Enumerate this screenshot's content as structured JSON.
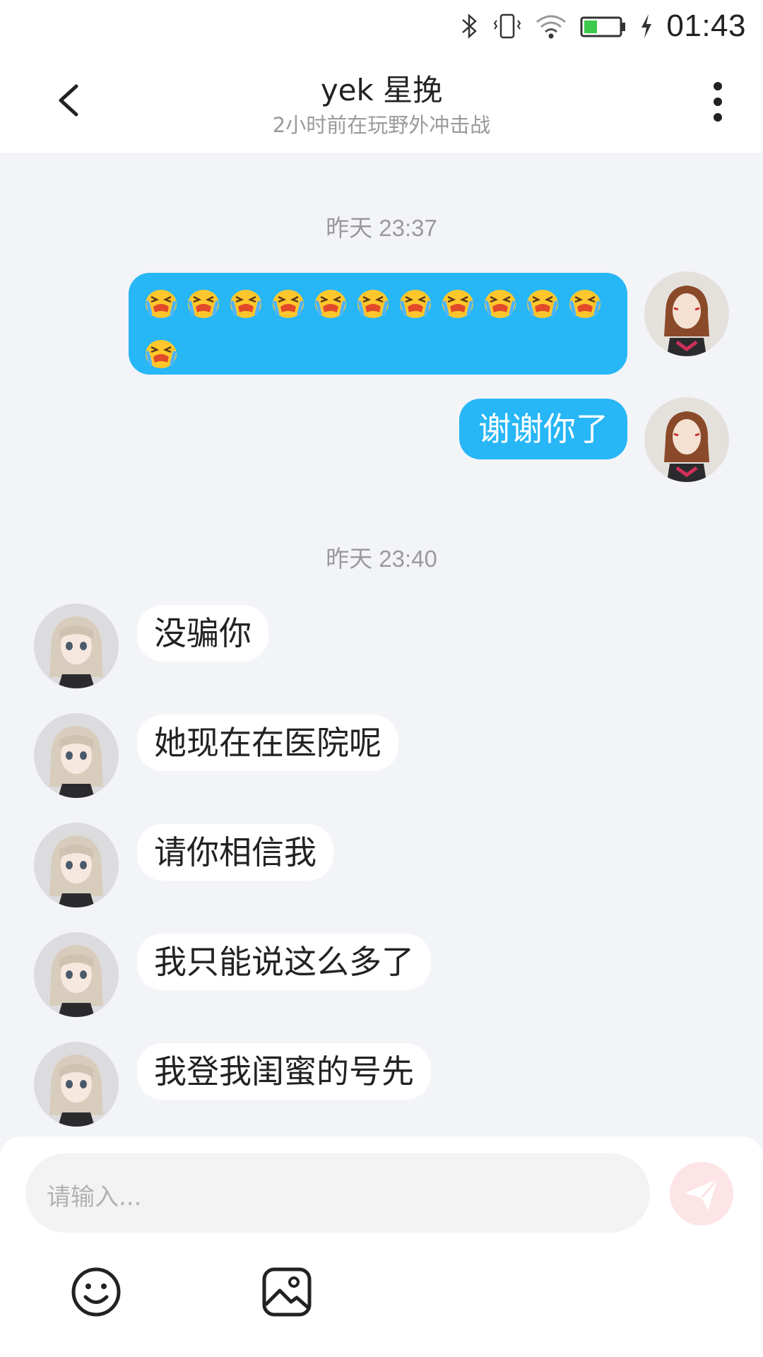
{
  "status_bar": {
    "time": "01:43",
    "battery_color": "#3cc84a"
  },
  "header": {
    "title": "yek 星挽",
    "subtitle": "2小时前在玩野外冲击战",
    "back_icon": "chevron-left-icon",
    "more_icon": "more-vertical-icon"
  },
  "chat": {
    "timestamps": [
      "昨天 23:37",
      "昨天 23:40"
    ],
    "outgoing": {
      "emoji_message": {
        "emoji": "crying-face",
        "count": 12
      },
      "text_message": "谢谢你了"
    },
    "incoming": [
      "没骗你",
      "她现在在医院呢",
      "请你相信我",
      "我只能说这么多了",
      "我登我闺蜜的号先"
    ]
  },
  "composer": {
    "placeholder": "请输入...",
    "send_icon": "send-icon",
    "emoji_icon": "smile-icon",
    "image_icon": "image-icon"
  },
  "colors": {
    "outgoing_bubble": "#27b6f6",
    "send_button": "#fde4e6",
    "chat_background": "#f3f4f8"
  }
}
